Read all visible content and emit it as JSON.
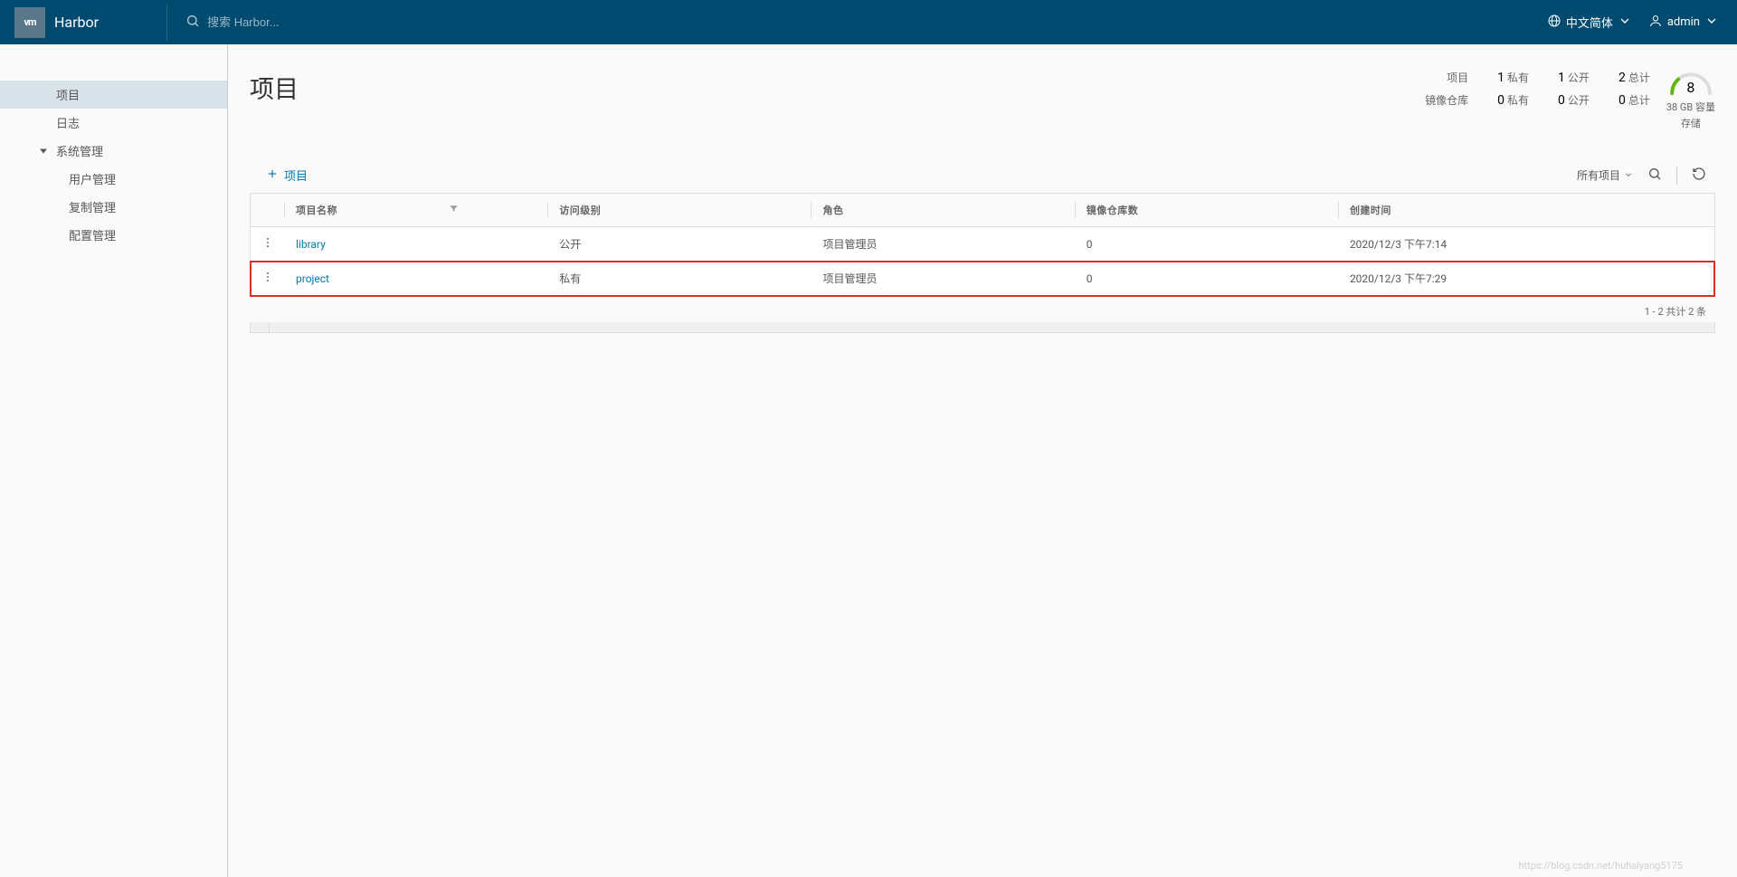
{
  "header": {
    "logo_text": "vm",
    "brand": "Harbor",
    "search_placeholder": "搜索 Harbor...",
    "language": "中文简体",
    "user": "admin"
  },
  "sidebar": {
    "items": [
      {
        "label": "项目",
        "active": true,
        "level": 1
      },
      {
        "label": "日志",
        "active": false,
        "level": 1
      },
      {
        "label": "系统管理",
        "active": false,
        "level": 1,
        "expandable": true
      },
      {
        "label": "用户管理",
        "active": false,
        "level": 2
      },
      {
        "label": "复制管理",
        "active": false,
        "level": 2
      },
      {
        "label": "配置管理",
        "active": false,
        "level": 2
      }
    ]
  },
  "page": {
    "title": "项目",
    "stats": {
      "row1_label": "项目",
      "row2_label": "镜像仓库",
      "private_label": "私有",
      "public_label": "公开",
      "total_label": "总计",
      "projects": {
        "private": "1",
        "public": "1",
        "total": "2"
      },
      "repos": {
        "private": "0",
        "public": "0",
        "total": "0"
      }
    },
    "storage": {
      "used": "8",
      "capacity": "38 GB 容量",
      "label": "存储"
    }
  },
  "toolbar": {
    "add_label": "项目",
    "filter_label": "所有项目"
  },
  "table": {
    "columns": {
      "name": "项目名称",
      "access": "访问级别",
      "role": "角色",
      "repo_count": "镜像仓库数",
      "created": "创建时间"
    },
    "rows": [
      {
        "name": "library",
        "access": "公开",
        "role": "项目管理员",
        "repo_count": "0",
        "created": "2020/12/3 下午7:14",
        "highlight": false
      },
      {
        "name": "project",
        "access": "私有",
        "role": "项目管理员",
        "repo_count": "0",
        "created": "2020/12/3 下午7:29",
        "highlight": true
      }
    ],
    "footer": "1 - 2 共计 2 条"
  },
  "watermark": "https://blog.csdn.net/huhaiyang5175"
}
